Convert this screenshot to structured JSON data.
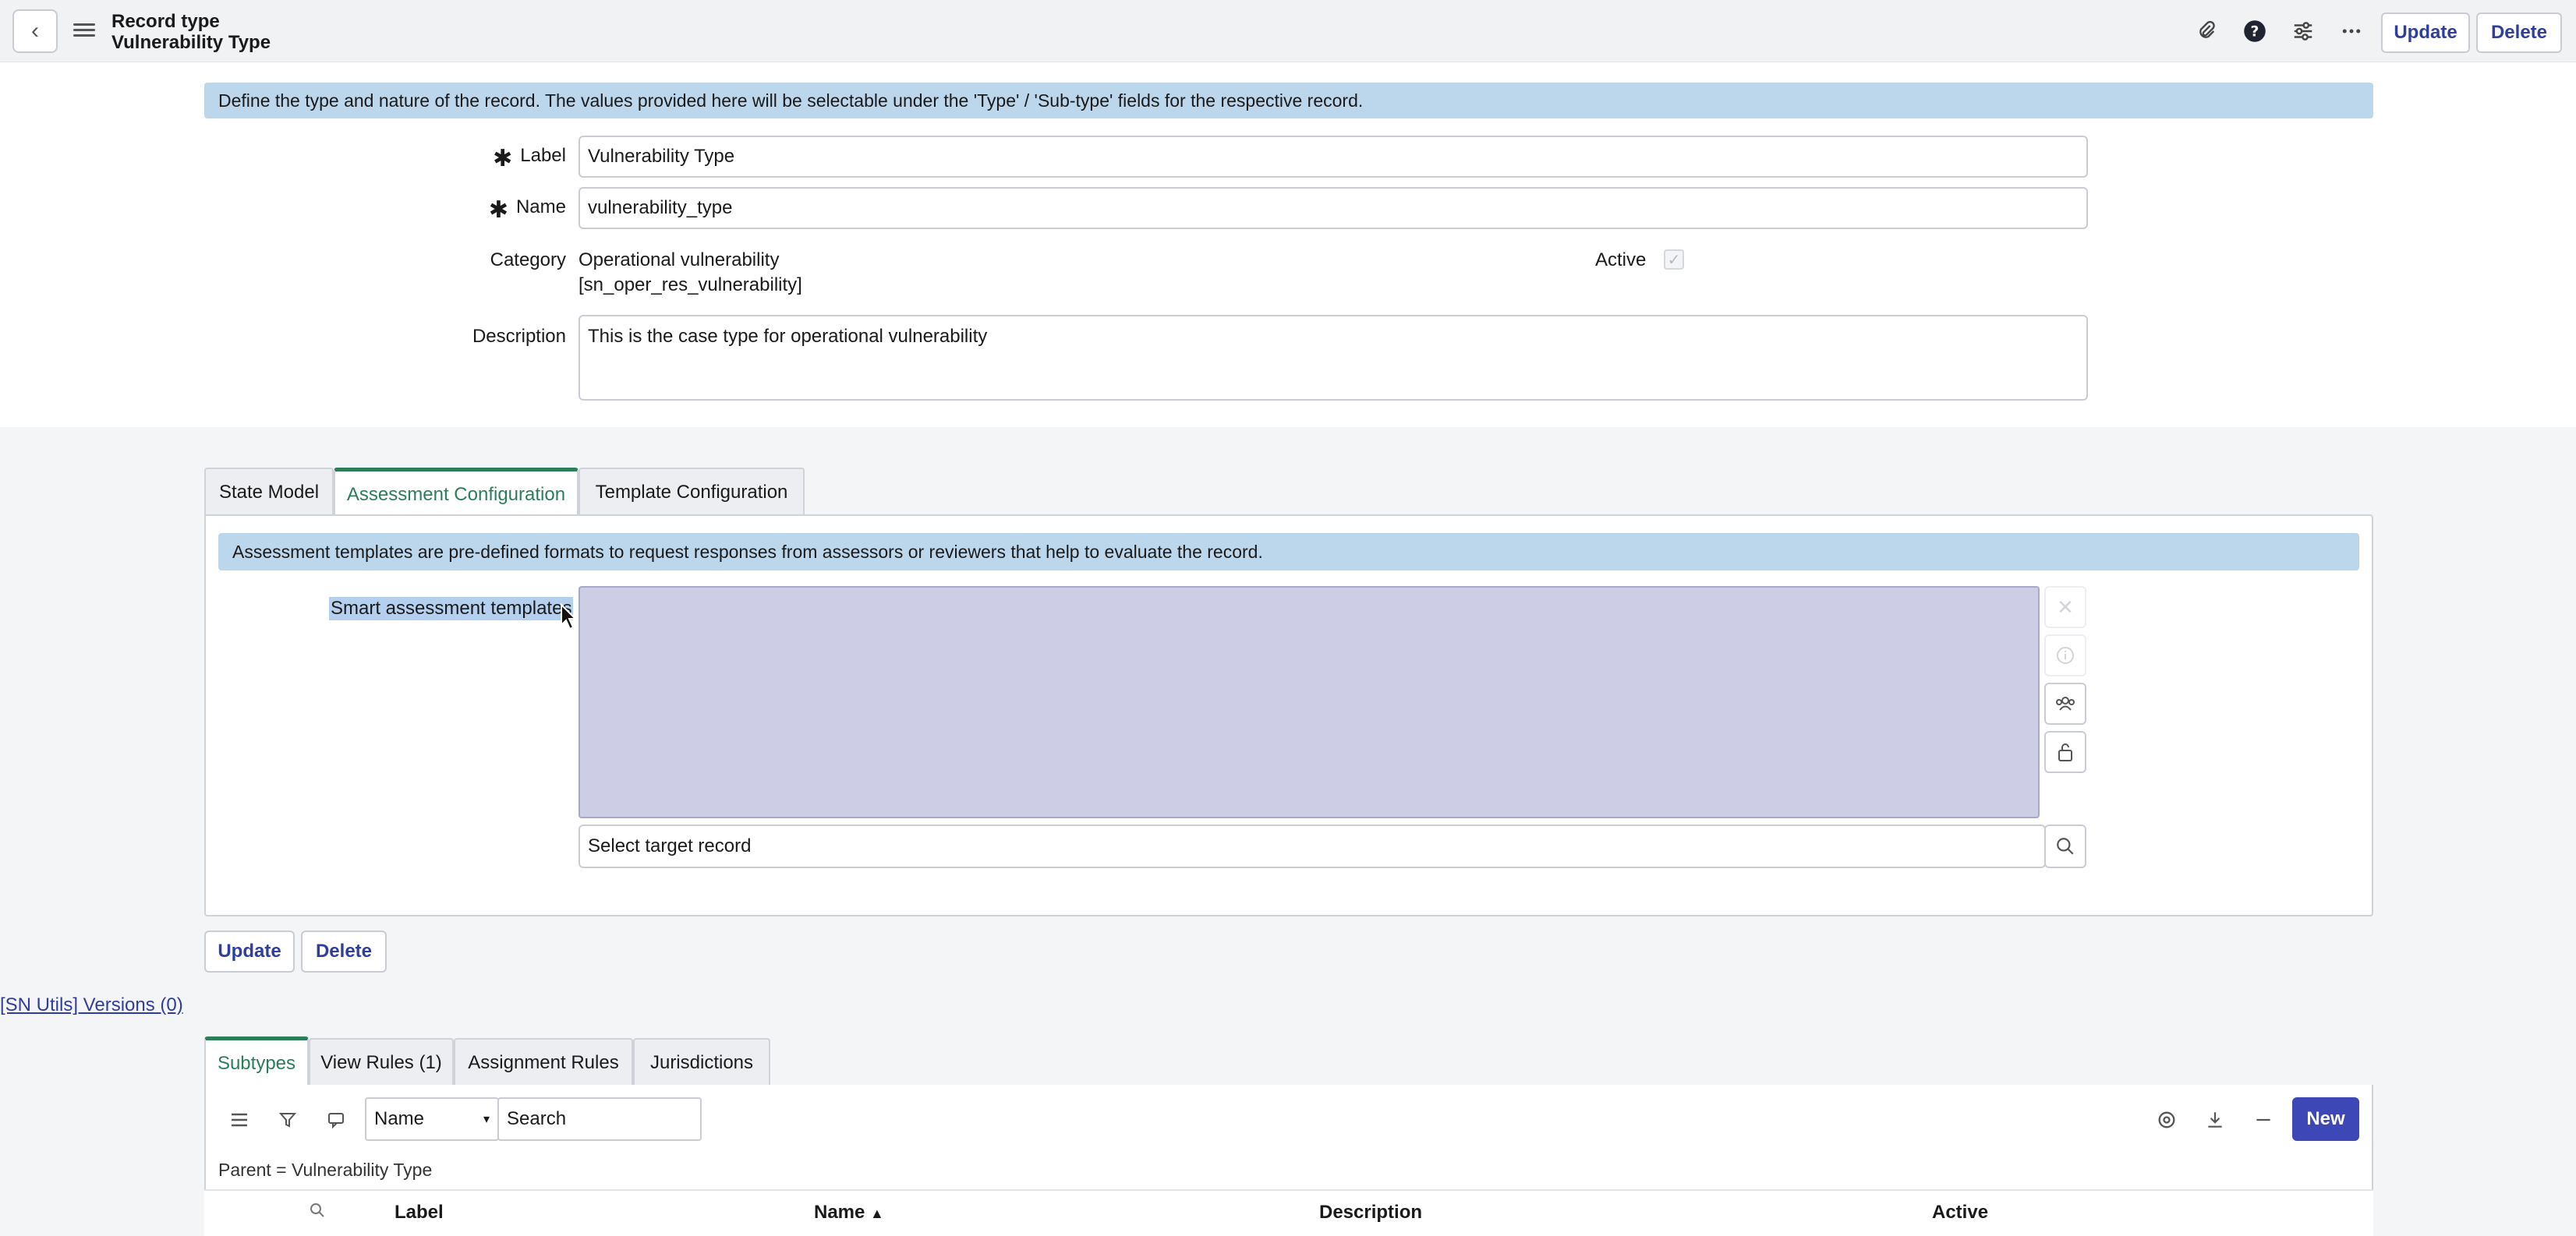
{
  "header": {
    "title_line1": "Record type",
    "title_line2": "Vulnerability Type",
    "update_label": "Update",
    "delete_label": "Delete",
    "icons": [
      "paperclip-icon",
      "help-icon",
      "sliders-icon",
      "more-icon"
    ]
  },
  "form": {
    "info_text": "Define the type and nature of the record. The values provided here will be selectable under the 'Type' / 'Sub-type' fields for the respective record.",
    "label": {
      "caption": "Label",
      "value": "Vulnerability Type",
      "required": true
    },
    "name": {
      "caption": "Name",
      "value": "vulnerability_type",
      "required": true
    },
    "category": {
      "caption": "Category",
      "value_line1": "Operational vulnerability",
      "value_line2": "[sn_oper_res_vulnerability]"
    },
    "active": {
      "caption": "Active",
      "checked": true
    },
    "description": {
      "caption": "Description",
      "value": "This is the case type for operational vulnerability"
    }
  },
  "section_tabs": {
    "tabs": [
      {
        "label": "State Model",
        "active": false
      },
      {
        "label": "Assessment Configuration",
        "active": true
      },
      {
        "label": "Template Configuration",
        "active": false
      }
    ],
    "info_text": "Assessment templates are pre-defined formats to request responses from assessors or reviewers that help to evaluate the record.",
    "smart_templates_label": "Smart assessment templates",
    "target_placeholder": "Select target record"
  },
  "bottom_buttons": {
    "update_label": "Update",
    "delete_label": "Delete"
  },
  "sn_utils_link": "[SN Utils] Versions (0)",
  "related_lists": {
    "tabs": [
      {
        "label": "Subtypes",
        "active": true
      },
      {
        "label": "View Rules (1)",
        "active": false
      },
      {
        "label": "Assignment Rules",
        "active": false
      },
      {
        "label": "Jurisdictions",
        "active": false
      }
    ],
    "search_field": "Name",
    "search_placeholder": "Search",
    "new_label": "New",
    "filter_text": "Parent = Vulnerability Type",
    "columns": [
      "Label",
      "Name",
      "Description",
      "Active"
    ],
    "sort_indicator": "▲"
  },
  "colors": {
    "accent": "#3d47b5",
    "tab_active": "#2a7e5a",
    "info_bar": "#bcd6ec"
  }
}
